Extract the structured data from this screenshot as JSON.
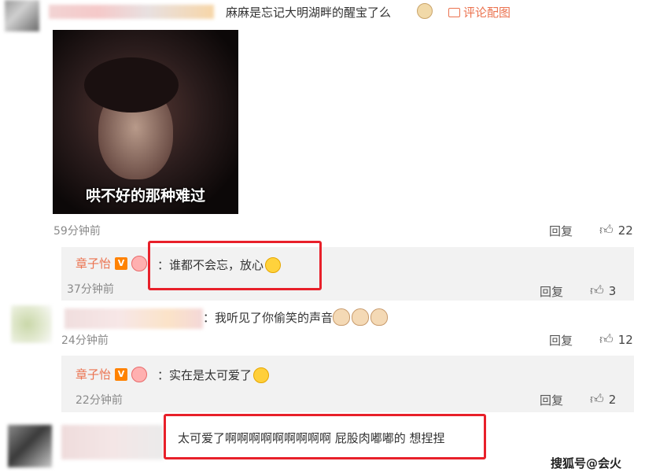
{
  "top_comment": {
    "text": "麻麻是忘记大明湖畔的醒宝了么",
    "image_link": "评论配图",
    "photo_caption": "哄不好的那种难过",
    "time": "59分钟前",
    "reply": "回复",
    "likes": "22"
  },
  "reply1": {
    "name": "章子怡",
    "text": "：谁都不会忘，放心",
    "time": "37分钟前",
    "reply": "回复",
    "likes": "3"
  },
  "comment2": {
    "text": "：我听见了你偷笑的声音",
    "time": "24分钟前",
    "reply": "回复",
    "likes": "12"
  },
  "reply2": {
    "name": "章子怡",
    "text": "：实在是太可爱了",
    "time": "22分钟前",
    "reply": "回复",
    "likes": "2"
  },
  "comment3": {
    "text": "太可爱了啊啊啊啊啊啊啊啊啊 屁股肉嘟嘟的 想捏捏"
  },
  "watermark": "搜狐号@会火",
  "colors": {
    "accent": "#eb7350",
    "highlight": "#e8202a",
    "badge": "#ff8200"
  }
}
